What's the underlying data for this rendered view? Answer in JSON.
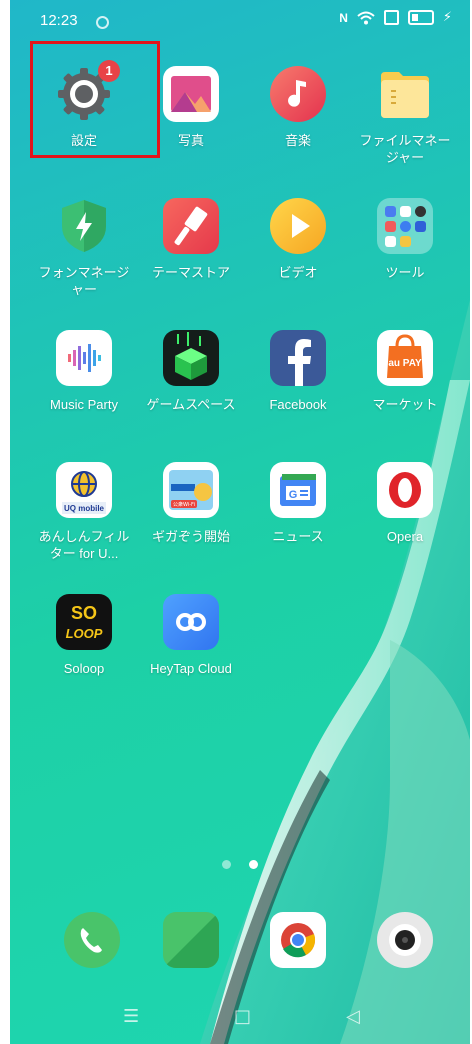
{
  "status_bar": {
    "time": "12:23",
    "nfc": "N"
  },
  "apps": [
    {
      "label": "設定",
      "icon": "settings-gear-icon",
      "badge": "1"
    },
    {
      "label": "写真",
      "icon": "photos-icon"
    },
    {
      "label": "音楽",
      "icon": "music-note-icon"
    },
    {
      "label": "ファイルマネージャー",
      "icon": "folder-icon"
    },
    {
      "label": "フォンマネージャー",
      "icon": "phone-manager-shield-icon"
    },
    {
      "label": "テーマストア",
      "icon": "theme-brush-icon"
    },
    {
      "label": "ビデオ",
      "icon": "video-play-icon"
    },
    {
      "label": "ツール",
      "icon": "tools-folder-icon"
    },
    {
      "label": "Music Party",
      "icon": "music-party-icon"
    },
    {
      "label": "ゲームスペース",
      "icon": "game-space-cube-icon"
    },
    {
      "label": "Facebook",
      "icon": "facebook-icon"
    },
    {
      "label": "マーケット",
      "icon": "au-pay-market-icon",
      "icon_text": "au PAY"
    },
    {
      "label": "あんしんフィルター for U...",
      "icon": "uq-filter-globe-icon",
      "icon_text": "UQ mobile"
    },
    {
      "label": "ギガぞう開始",
      "icon": "gigazo-wifi-icon",
      "icon_text": "公衆Wi-Fi"
    },
    {
      "label": "ニュース",
      "icon": "google-news-icon",
      "icon_text": "G"
    },
    {
      "label": "Opera",
      "icon": "opera-icon",
      "icon_text": "O"
    },
    {
      "label": "Soloop",
      "icon": "soloop-icon",
      "icon_text": "SO\nLOOP"
    },
    {
      "label": "HeyTap Cloud",
      "icon": "heytap-cloud-icon",
      "icon_text": "∞"
    }
  ],
  "dock": [
    {
      "icon": "phone-call-icon"
    },
    {
      "icon": "messages-icon"
    },
    {
      "icon": "chrome-icon"
    },
    {
      "icon": "camera-icon"
    }
  ],
  "pager": {
    "pages": 2,
    "active": 2
  },
  "nav": {
    "menu": "☰",
    "home": "□",
    "back": "◁"
  }
}
